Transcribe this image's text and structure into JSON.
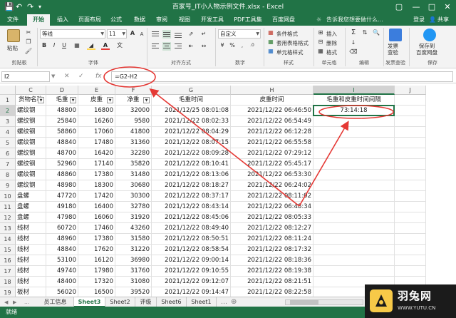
{
  "titlebar": {
    "title": "百家号_IT小人物示例文件.xlsx - Excel",
    "qa_icons": [
      "save-icon",
      "undo-icon",
      "redo-icon",
      "customize-icon"
    ]
  },
  "ribbon_tabs": [
    "文件",
    "开始",
    "插入",
    "页面布局",
    "公式",
    "数据",
    "审阅",
    "视图",
    "开发工具",
    "PDF工具集",
    "百度网盘"
  ],
  "active_tab": "开始",
  "tell_me": "告诉我您想要做什么...",
  "account": {
    "login": "登录",
    "share": "共享"
  },
  "ribbon": {
    "paste": "粘贴",
    "clipboard": "剪贴板",
    "font_name": "等线",
    "font_size": "11",
    "font": "字体",
    "align": "对齐方式",
    "number_format": "自定义",
    "number": "数字",
    "cond_format": "条件格式",
    "table_format": "套用表格格式",
    "cell_style": "单元格样式",
    "styles": "样式",
    "insert": "插入",
    "delete": "删除",
    "format": "格式",
    "cells": "单元格",
    "editing": "编辑",
    "invoice_check": "发票\n查验",
    "save_to_baidu": "保存到\n百度网盘",
    "invoice_group": "发票查验",
    "save_group": "保存"
  },
  "formula_bar": {
    "name_box": "I2",
    "formula": "=G2-H2"
  },
  "grid": {
    "columns": [
      "C",
      "D",
      "E",
      "F",
      "G",
      "H",
      "I",
      "J"
    ],
    "headers": [
      "货物名称",
      "毛重",
      "皮重",
      "净重",
      "毛重时间",
      "皮重时间",
      "毛重和皮重时间间隔",
      ""
    ],
    "rows": [
      [
        "螺纹钢",
        "48800",
        "16800",
        "32000",
        "2021/12/25 08:01:08",
        "2021/12/22 06:46:50",
        "73:14:18",
        ""
      ],
      [
        "螺纹钢",
        "25840",
        "16260",
        "9580",
        "2021/12/22 08:02:33",
        "2021/12/22 06:54:49",
        "",
        ""
      ],
      [
        "螺纹钢",
        "58860",
        "17060",
        "41800",
        "2021/12/22 08:04:29",
        "2021/12/22 06:12:28",
        "",
        ""
      ],
      [
        "螺纹钢",
        "48840",
        "17480",
        "31360",
        "2021/12/22 08:07:15",
        "2021/12/22 06:55:58",
        "",
        ""
      ],
      [
        "螺纹钢",
        "48700",
        "16420",
        "32280",
        "2021/12/22 08:09:28",
        "2021/12/22 07:29:12",
        "",
        ""
      ],
      [
        "螺纹钢",
        "52960",
        "17140",
        "35820",
        "2021/12/22 08:10:41",
        "2021/12/22 05:45:17",
        "",
        ""
      ],
      [
        "螺纹钢",
        "48860",
        "17380",
        "31480",
        "2021/12/22 08:13:06",
        "2021/12/22 06:53:30",
        "",
        ""
      ],
      [
        "螺纹钢",
        "48980",
        "18300",
        "30680",
        "2021/12/22 08:18:27",
        "2021/12/22 06:24:02",
        "",
        ""
      ],
      [
        "盘螺",
        "47720",
        "17420",
        "30300",
        "2021/12/22 08:37:17",
        "2021/12/22 08:11:02",
        "",
        ""
      ],
      [
        "盘螺",
        "49180",
        "16400",
        "32780",
        "2021/12/22 08:43:14",
        "2021/12/22 06:48:34",
        "",
        ""
      ],
      [
        "盘螺",
        "47980",
        "16060",
        "31920",
        "2021/12/22 08:45:06",
        "2021/12/22 08:05:33",
        "",
        ""
      ],
      [
        "线材",
        "60720",
        "17460",
        "43260",
        "2021/12/22 08:49:40",
        "2021/12/22 08:12:27",
        "",
        ""
      ],
      [
        "线材",
        "48960",
        "17380",
        "31580",
        "2021/12/22 08:50:51",
        "2021/12/22 08:11:24",
        "",
        ""
      ],
      [
        "线材",
        "48840",
        "17620",
        "31220",
        "2021/12/22 08:58:54",
        "2021/12/22 08:17:32",
        "",
        ""
      ],
      [
        "线材",
        "53100",
        "16120",
        "36980",
        "2021/12/22 09:00:14",
        "2021/12/22 08:18:36",
        "",
        ""
      ],
      [
        "线材",
        "49740",
        "17980",
        "31760",
        "2021/12/22 09:10:55",
        "2021/12/22 08:19:38",
        "",
        ""
      ],
      [
        "线材",
        "48400",
        "17320",
        "31080",
        "2021/12/22 09:12:07",
        "2021/12/22 08:21:51",
        "",
        ""
      ],
      [
        "板材",
        "56020",
        "16500",
        "39520",
        "2021/12/22 09:14:47",
        "2021/12/22 08:22:58",
        "",
        ""
      ]
    ],
    "row_numbers": [
      "1",
      "2",
      "3",
      "4",
      "5",
      "6",
      "7",
      "8",
      "9",
      "10",
      "11",
      "12",
      "13",
      "14",
      "15",
      "16",
      "17",
      "18",
      "19"
    ],
    "selected_cell": "I2"
  },
  "sheets": [
    "员工信息",
    "Sheet3",
    "Sheet2",
    "评级",
    "Sheet6",
    "Sheet1"
  ],
  "active_sheet": "Sheet3",
  "status": {
    "ready": "就绪"
  },
  "watermark": {
    "cn": "羽兔网",
    "url": "WWW.YUTU.CN"
  },
  "colors": {
    "excel_green": "#217346",
    "annotation_red": "#e53935"
  }
}
